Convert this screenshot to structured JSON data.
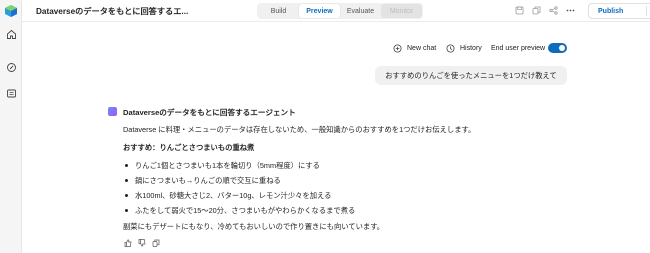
{
  "header": {
    "title": "Dataverseのデータをもとに回答するエ...",
    "tabs": [
      {
        "label": "Build",
        "state": "default"
      },
      {
        "label": "Preview",
        "state": "active"
      },
      {
        "label": "Evaluate",
        "state": "default"
      },
      {
        "label": "Monitor",
        "state": "disabled"
      }
    ],
    "publish_label": "Publish",
    "icons": [
      "save-icon",
      "copy-icon",
      "share-icon",
      "more-icon"
    ]
  },
  "rail": {
    "icons": [
      "home-icon",
      "explore-icon",
      "library-icon"
    ]
  },
  "chat_toolbar": {
    "new_chat": "New chat",
    "history": "History",
    "end_user_preview": "End user preview",
    "toggle_on": true
  },
  "user_message": "おすすめのりんごを使ったメニューを1つだけ教えて",
  "agent": {
    "name": "Dataverseのデータをもとに回答するエージェント",
    "intro": "Dataverse に料理・メニューのデータは存在しないため、一般知識からのおすすめを1つだけお伝えします。",
    "recommend_heading": "おすすめ：りんごとさつまいもの重ね煮",
    "steps": [
      "りんご1個とさつまいも1本を輪切り（5mm程度）にする",
      "鍋にさつまいも→りんごの順で交互に重ねる",
      "水100ml、砂糖大さじ2、バター10g、レモン汁少々を加える",
      "ふたをして弱火で15〜20分、さつまいもがやわらかくなるまで煮る"
    ],
    "closing": "副菜にもデザートにもなり、冷めてもおいしいので作り置きにも向いています。"
  },
  "colors": {
    "accent": "#0f6cbd",
    "rail_bg": "#f5f5f5",
    "bubble_bg": "#f0f0f0"
  }
}
